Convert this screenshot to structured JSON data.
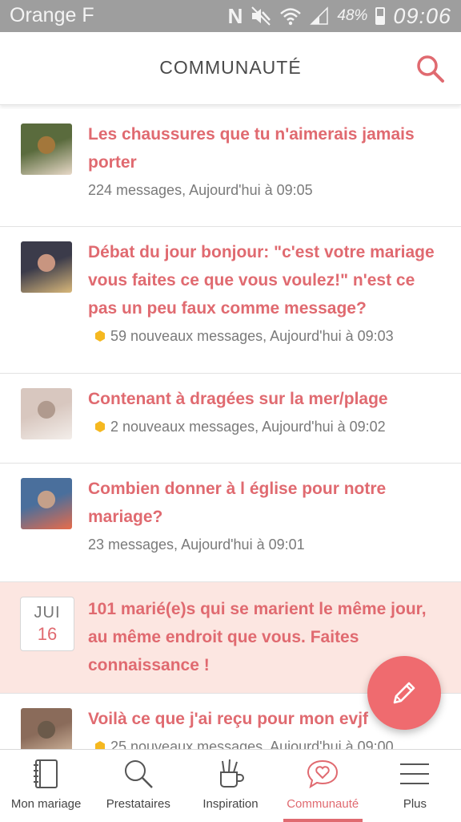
{
  "status_bar": {
    "carrier": "Orange F",
    "battery": "48%",
    "battery_level": 0.48,
    "time": "09:06"
  },
  "header": {
    "title": "COMMUNAUTÉ"
  },
  "feed": [
    {
      "type": "thread",
      "title": "Les chaussures que tu n'aimerais jamais porter",
      "meta": "224 messages, Aujourd'hui à 09:05",
      "unread": false,
      "avatar_colors": [
        "#5a6b3d",
        "#e8d9c8",
        "#a3773b"
      ]
    },
    {
      "type": "thread",
      "title": "Débat du jour bonjour: \"c'est votre mariage vous faites ce que vous voulez!\" n'est ce pas un peu faux comme message?",
      "meta": "59 nouveaux messages, Aujourd'hui à 09:03",
      "unread": true,
      "avatar_colors": [
        "#3b3b4a",
        "#d9b87a",
        "#c89580"
      ]
    },
    {
      "type": "thread",
      "title": "Contenant à dragées sur la mer/plage",
      "meta": "2 nouveaux messages, Aujourd'hui à 09:02",
      "unread": true,
      "avatar_colors": [
        "#d8c7bf",
        "#f3eeea",
        "#b09a8e"
      ]
    },
    {
      "type": "thread",
      "title": "Combien donner à l église pour notre mariage?",
      "meta": "23 messages, Aujourd'hui à 09:01",
      "unread": false,
      "avatar_colors": [
        "#4a6f9c",
        "#e86b4a",
        "#c4a08a"
      ]
    },
    {
      "type": "event",
      "month": "JUI",
      "day": "16",
      "title": "101 marié(e)s qui se marient le même jour, au même endroit que vous. Faites connaissance !"
    },
    {
      "type": "thread",
      "title": "Voilà ce que j'ai reçu pour mon evjf",
      "meta": "25 nouveaux messages, Aujourd'hui à 09:00",
      "unread": true,
      "avatar_colors": [
        "#8a6b5a",
        "#dcc2a8",
        "#6b5a4a"
      ]
    }
  ],
  "colors": {
    "accent": "#e06a70",
    "fab": "#ef6b6f",
    "event_bg": "#fce6e1",
    "unread_dot": "#f5b820",
    "status_bar": "#9e9e9e"
  },
  "bottom_nav": [
    {
      "label": "Mon mariage",
      "icon": "notebook-icon",
      "active": false
    },
    {
      "label": "Prestataires",
      "icon": "search-icon",
      "active": false
    },
    {
      "label": "Inspiration",
      "icon": "pencil-cup-icon",
      "active": false
    },
    {
      "label": "Communauté",
      "icon": "chat-heart-icon",
      "active": true
    },
    {
      "label": "Plus",
      "icon": "menu-icon",
      "active": false
    }
  ]
}
